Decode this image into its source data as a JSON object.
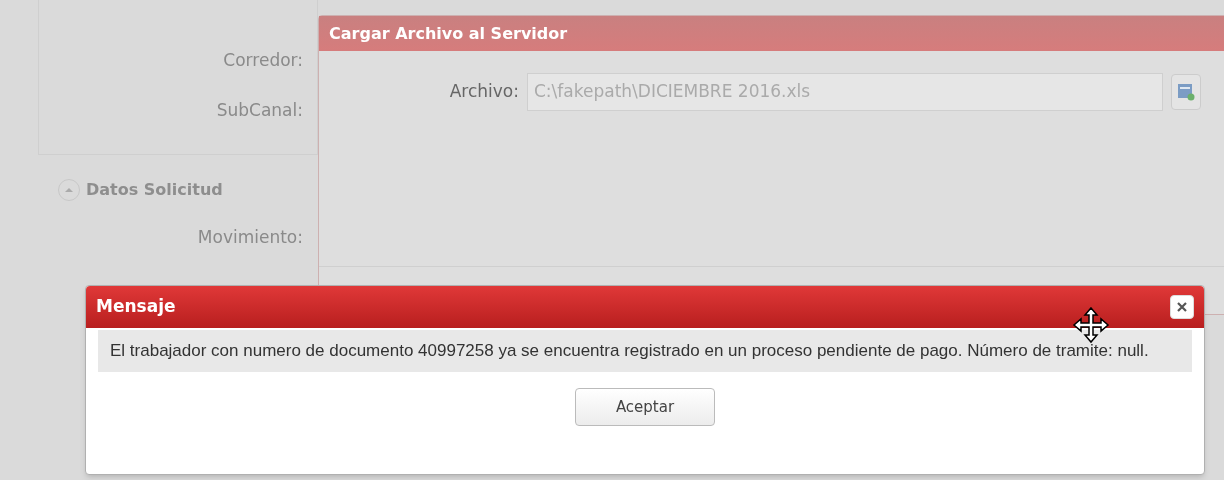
{
  "background_form": {
    "fields": [
      {
        "label": "Corredor:"
      },
      {
        "label": "SubCanal:"
      }
    ],
    "section": {
      "title": "Datos Solicitud",
      "expanded": true,
      "fields": [
        {
          "label": "Movimiento:"
        }
      ]
    }
  },
  "upload_window": {
    "title": "Cargar Archivo al Servidor",
    "field": {
      "label": "Archivo:",
      "value": "C:\\fakepath\\DICIEMBRE 2016.xls"
    }
  },
  "message_window": {
    "title": "Mensaje",
    "text": "El trabajador con numero de documento 40997258 ya se encuentra registrado en un proceso pendiente de pago. Número de tramite: null.",
    "buttons": [
      "Aceptar"
    ]
  }
}
